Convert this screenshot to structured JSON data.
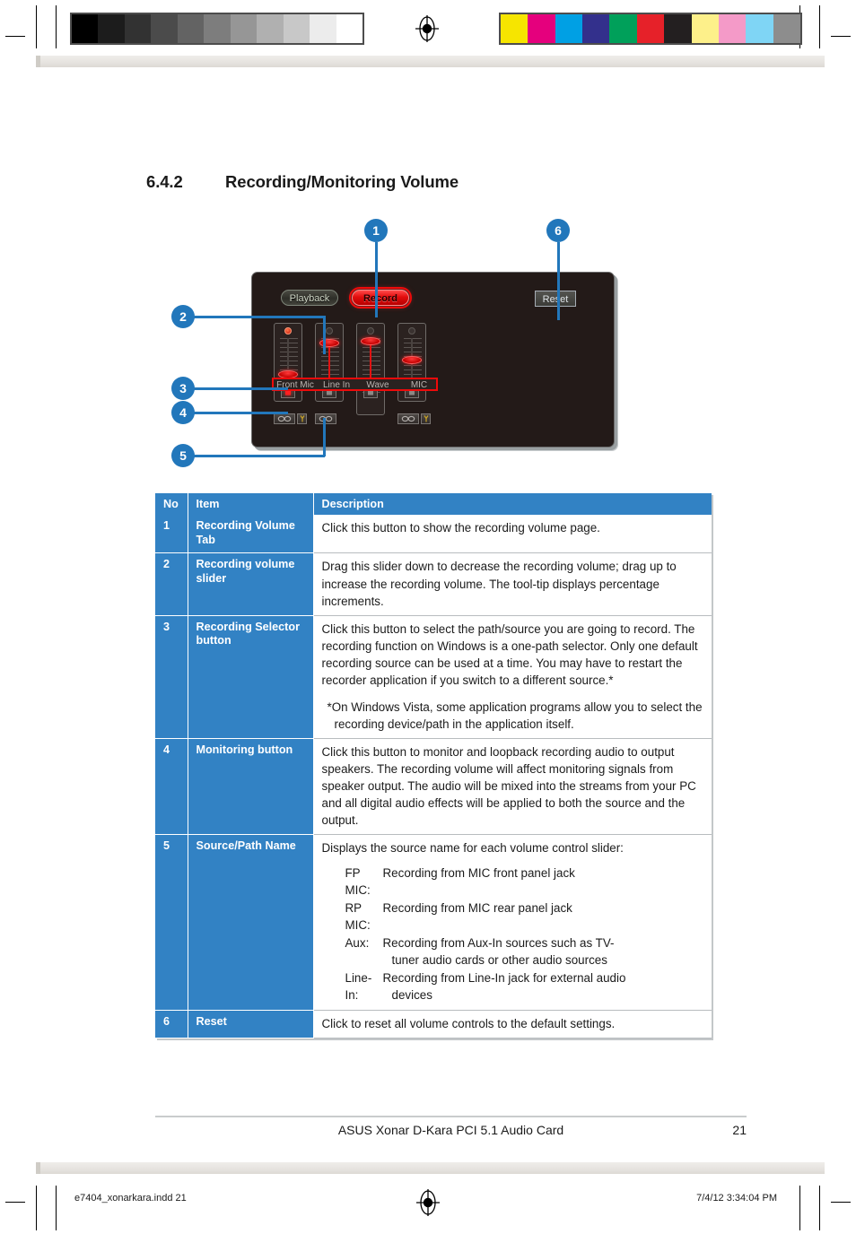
{
  "print_marks": {
    "gray_swatches": [
      "#000000",
      "#1c1c1c",
      "#323232",
      "#4b4b4b",
      "#636363",
      "#7d7d7d",
      "#969696",
      "#b0b0b0",
      "#c8c8c8",
      "#ececec",
      "#ffffff"
    ],
    "color_swatches": [
      "#f6e500",
      "#e5007d",
      "#00a0e4",
      "#33308c",
      "#00a05a",
      "#e62129",
      "#231f20",
      "#fdf08a",
      "#f49ac8",
      "#7fd5f5",
      "#8d8d8d"
    ],
    "registration_icon": "registration-target-icon"
  },
  "heading": {
    "number": "6.4.2",
    "title": "Recording/Monitoring Volume"
  },
  "figure": {
    "callouts": [
      {
        "id": "1",
        "label": "1"
      },
      {
        "id": "2",
        "label": "2"
      },
      {
        "id": "3",
        "label": "3"
      },
      {
        "id": "4",
        "label": "4"
      },
      {
        "id": "5",
        "label": "5"
      },
      {
        "id": "6",
        "label": "6"
      }
    ],
    "panel": {
      "tabs": [
        {
          "name": "playback",
          "label": "Playback",
          "active": false
        },
        {
          "name": "record",
          "label": "Record",
          "active": true
        }
      ],
      "reset_label": "Reset",
      "channels": [
        {
          "label": "Front Mic",
          "level": 24,
          "led": true,
          "muted": true,
          "has_monitor": true,
          "has_selector": true
        },
        {
          "label": "Line In",
          "level": 94,
          "led": false,
          "muted": false,
          "has_monitor": false,
          "has_selector": true
        },
        {
          "label": "Wave",
          "level": 95,
          "led": false,
          "muted": false,
          "has_monitor": false,
          "has_selector": false
        },
        {
          "label": "MIC",
          "level": 62,
          "led": false,
          "muted": false,
          "has_monitor": true,
          "has_selector": true
        }
      ],
      "icons": {
        "selector": "recording-selector-icon",
        "monitor": "monitoring-icon",
        "mute": "mute-icon",
        "led": "signal-led-icon"
      }
    },
    "highlight_color": "#ee0a0a",
    "callout_color": "#2277bb"
  },
  "table": {
    "headers": [
      "No",
      "Item",
      "Description"
    ],
    "rows": [
      {
        "no": "1",
        "item": "Recording Volume Tab",
        "desc": "Click this button to show the recording volume page."
      },
      {
        "no": "2",
        "item": "Recording volume slider",
        "desc": "Drag this slider down to decrease the recording volume; drag up to increase the recording volume. The tool-tip displays percentage increments."
      },
      {
        "no": "3",
        "item": "Recording Selector button",
        "desc": "Click this button to select the path/source you are going to record. The recording function on Windows is a one-path selector. Only one default recording source can be used at a time. You may have to restart the recorder application if you switch to a different source.*",
        "note": "*On Windows Vista, some application programs allow you to select the recording device/path in the application itself."
      },
      {
        "no": "4",
        "item": "Monitoring button",
        "desc": "Click this button to monitor and loopback recording audio to output speakers.  The recording volume will affect monitoring signals from speaker output.  The audio will be mixed into the streams from your PC and all digital audio effects will be applied to both the source and the output."
      },
      {
        "no": "5",
        "item": "Source/Path Name",
        "desc": "Displays the source name for each volume control slider:",
        "definitions": [
          {
            "term": "FP MIC:",
            "def": "Recording from MIC front panel jack",
            "cont": ""
          },
          {
            "term": "RP MIC:",
            "def": "Recording from MIC rear panel jack",
            "cont": ""
          },
          {
            "term": "Aux:",
            "def": "Recording from Aux-In sources such as TV-",
            "cont": "tuner audio cards or other audio sources"
          },
          {
            "term": "Line-In:",
            "def": "Recording from Line-In jack for external audio",
            "cont": "devices"
          }
        ]
      },
      {
        "no": "6",
        "item": "Reset",
        "desc": "Click to reset all volume controls to the default settings."
      }
    ]
  },
  "footer": {
    "title": "ASUS Xonar D-Kara PCI 5.1 Audio Card",
    "page_number": "21",
    "imprint_file": "e7404_xonarkara.indd   21",
    "imprint_date": "7/4/12   3:34:04 PM"
  }
}
